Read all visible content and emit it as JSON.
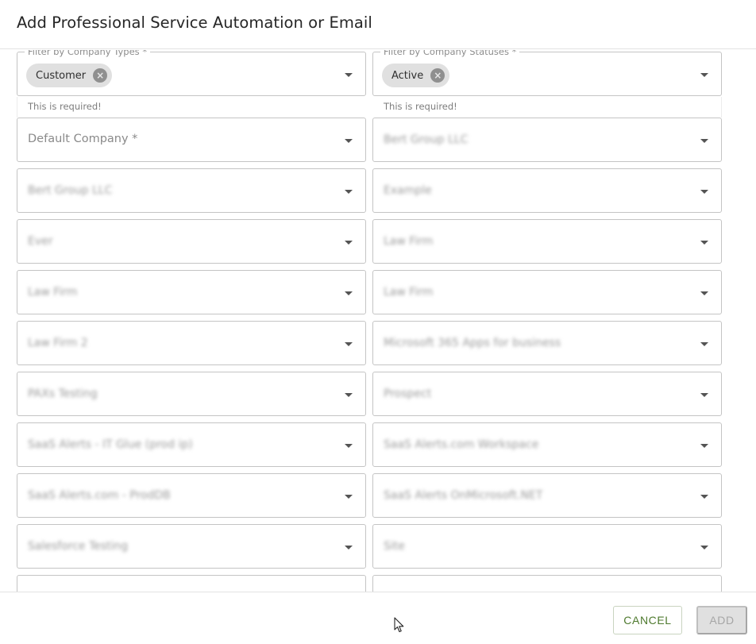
{
  "dialog": {
    "title": "Add Professional Service Automation or Email"
  },
  "filters": {
    "company_types": {
      "label": "Filter by Company Types *",
      "chips": [
        "Customer"
      ],
      "helper": "This is required!"
    },
    "company_statuses": {
      "label": "Filter by Company Statuses *",
      "chips": [
        "Active"
      ],
      "helper": "This is required!"
    }
  },
  "default_company": {
    "placeholder": "Default Company *"
  },
  "mapping_rows": [
    {
      "left": "",
      "right": "Bert Group LLC"
    },
    {
      "left": "Bert Group LLC",
      "right": "Example"
    },
    {
      "left": "Ever",
      "right": "Law Firm"
    },
    {
      "left": "Law Firm",
      "right": "Law Firm"
    },
    {
      "left": "Law Firm 2",
      "right": "Microsoft 365 Apps for business"
    },
    {
      "left": "PAXs Testing",
      "right": "Prospect"
    },
    {
      "left": "SaaS Alerts - IT Glue (prod ip)",
      "right": "SaaS Alerts.com Workspace"
    },
    {
      "left": "SaaS Alerts.com - ProdDB",
      "right": "SaaS Alerts OnMicrosoft.NET"
    },
    {
      "left": "Salesforce Testing",
      "right": "Site"
    }
  ],
  "footer": {
    "cancel_label": "CANCEL",
    "add_label": "ADD"
  },
  "icons": {
    "chip_remove": "close-circle-icon",
    "dropdown": "caret-down-icon",
    "cursor": "mouse-pointer-icon"
  },
  "colors": {
    "accent": "#4e7a2e",
    "disabled_bg": "#e0e0e0",
    "border": "#c4c4c4"
  }
}
